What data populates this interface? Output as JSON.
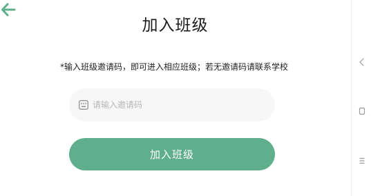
{
  "header": {
    "title": "加入班级",
    "back_icon": "arrow-left-icon"
  },
  "hint": {
    "text": "*输入班级邀请码，即可进入相应班级；若无邀请码请联系学校"
  },
  "invite_code": {
    "placeholder": "请输入邀请码",
    "value": "",
    "icon": "keyboard-icon"
  },
  "join_button": {
    "label": "加入班级"
  },
  "system_nav": {
    "back_icon": "nav-back-icon",
    "home_icon": "nav-home-icon",
    "menu_icon": "nav-menu-icon"
  },
  "colors": {
    "accent": "#5fae8c",
    "input_background": "#f7f7f7",
    "title_text": "#1a1a1a",
    "placeholder": "#b8b8b8"
  }
}
